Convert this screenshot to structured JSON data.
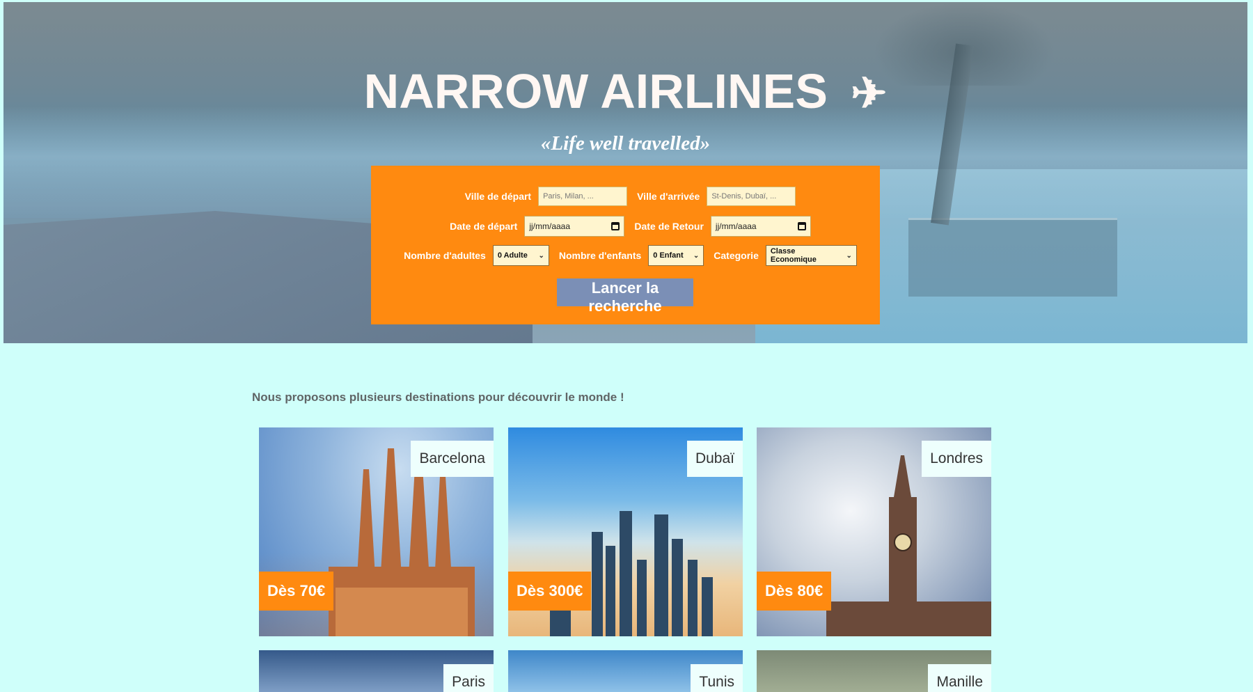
{
  "brand": {
    "title": "NARROW AIRLINES",
    "plane_icon": "✈",
    "tagline": "«Life well travelled»"
  },
  "search": {
    "departure_city_label": "Ville de départ",
    "departure_city_placeholder": "Paris, Milan, ...",
    "arrival_city_label": "Ville d'arrivée",
    "arrival_city_placeholder": "St-Denis, Dubaï, ...",
    "departure_date_label": "Date de départ",
    "departure_date_value": "jj/mm/aaaa",
    "return_date_label": "Date de Retour",
    "return_date_value": "jj/mm/aaaa",
    "adults_label": "Nombre d'adultes",
    "adults_value": "0 Adulte",
    "children_label": "Nombre d'enfants",
    "children_value": "0 Enfant",
    "category_label": "Categorie",
    "category_value": "Classe Economique",
    "submit_label": "Lancer la recherche"
  },
  "destinations": {
    "intro": "Nous proposons plusieurs destinations pour découvrir le monde !",
    "cards": [
      {
        "city": "Barcelona",
        "price": "Dès 70€"
      },
      {
        "city": "Dubaï",
        "price": "Dès 300€"
      },
      {
        "city": "Londres",
        "price": "Dès 80€"
      },
      {
        "city": "Paris",
        "price": ""
      },
      {
        "city": "Tunis",
        "price": ""
      },
      {
        "city": "Manille",
        "price": ""
      }
    ]
  },
  "colors": {
    "page_bg": "#cffffa",
    "accent_orange": "#ff8a10",
    "button_blue": "#7b8fb6",
    "input_bg": "#fff5cf"
  }
}
